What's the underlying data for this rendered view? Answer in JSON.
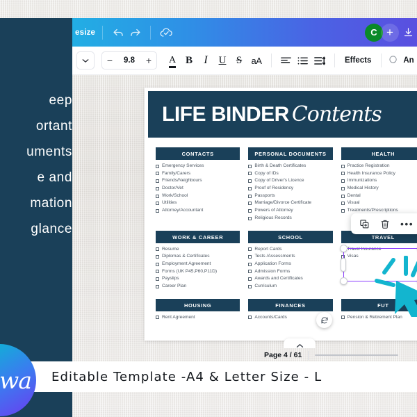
{
  "app": {
    "name": "Canva editor",
    "topbar": {
      "resize_label": "esize",
      "undo_icon": "undo-icon",
      "redo_icon": "redo-icon",
      "cloud_saved_icon": "cloud-check-icon",
      "avatar_initial": "C",
      "add_member_label": "+",
      "download_icon": "download-icon"
    },
    "formatbar": {
      "font_dropdown_icon": "chevron-down-icon",
      "font_size_decrease": "−",
      "font_size_value": "9.8",
      "font_size_increase": "+",
      "text_color_label": "A",
      "bold_label": "B",
      "italic_label": "I",
      "underline_label": "U",
      "strikethrough_label": "S",
      "case_label": "aA",
      "align_icon": "text-align-icon",
      "list_icon": "bullet-list-icon",
      "spacing_icon": "line-spacing-icon",
      "effects_label": "Effects",
      "animate_label": "An"
    },
    "element_toolbar": {
      "duplicate_icon": "duplicate-icon",
      "delete_icon": "trash-icon",
      "more_label": "•••"
    },
    "footer": {
      "page_label": "Page 4 / 61",
      "scroll_chevron": "chevron-up-icon"
    },
    "rotate_icon": "rotate-icon"
  },
  "sidebar": {
    "lines": [
      "eep",
      "ortant",
      "uments",
      "e and",
      "mation",
      "glance"
    ],
    "brand_text": "wa"
  },
  "promo": {
    "text": "Editable Template -A4 & Letter Size - L"
  },
  "document": {
    "title_main": "LIFE BINDER",
    "title_script": "Contents",
    "categories": [
      {
        "heading": "CONTACTS",
        "items": [
          "Emergency Services",
          "Family/Carers",
          "Friends/Neighbours",
          "Doctor/Vet",
          "Work/School",
          "Utilities",
          "Attorney/Accountant"
        ]
      },
      {
        "heading": "PERSONAL DOCUMENTS",
        "items": [
          "Birth & Death Certificates",
          "Copy of IDs",
          "Copy of Driver's Licence",
          "Proof of Residency",
          "Passports",
          "Marriage/Divorce Certificate",
          "Powers of Attorney",
          "Religious Records"
        ]
      },
      {
        "heading": "HEALTH",
        "items": [
          "Practice Registration",
          "Health Insurance Policy",
          "Immunizations",
          "Medical History",
          "Dental",
          "Visual",
          "Treatments/Prescriptions"
        ]
      },
      {
        "heading": "WORK & CAREER",
        "items": [
          "Resume",
          "Diplomas & Certificates",
          "Employment Agreement",
          "Forms (UK P45,P60,P11D)",
          "Payslips",
          "Career Plan"
        ]
      },
      {
        "heading": "SCHOOL",
        "items": [
          "Report Cards",
          "Tests /Assessments",
          "Application Forms",
          "Admission Forms",
          "Awards and Certificates",
          "Curriculum"
        ]
      },
      {
        "heading": "TRAVEL",
        "items": [
          "Travel Insurance",
          "Visas",
          ""
        ]
      },
      {
        "heading": "HOUSING",
        "items": [
          "Rent Agreement"
        ]
      },
      {
        "heading": "FINANCES",
        "items": [
          "Accounts/Cards"
        ]
      },
      {
        "heading": "FUT",
        "items": [
          "Pension & Retirement Plan"
        ]
      }
    ]
  },
  "colors": {
    "navy": "#1a4059",
    "gradient_start": "#22aee4",
    "gradient_end": "#5a4fe0",
    "selection_purple": "#8b3dff",
    "cursor_cyan": "#13b5cf",
    "avatar_green": "#0a8a28"
  }
}
